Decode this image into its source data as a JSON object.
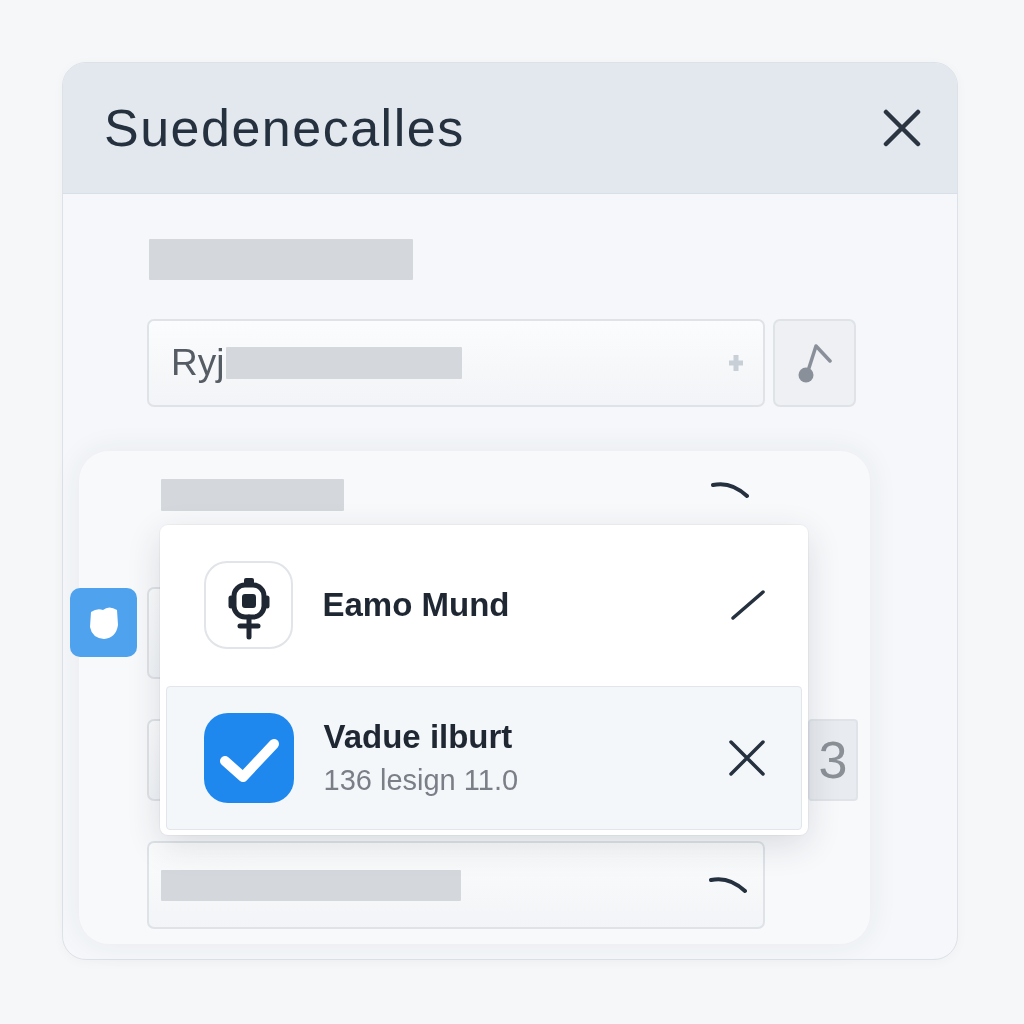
{
  "dialog": {
    "title": "Suedenecalles"
  },
  "name_input": {
    "value": "Ryj"
  },
  "rows": [
    {
      "kind": "badge_field"
    },
    {
      "kind": "count_field",
      "count": "3"
    },
    {
      "kind": "select_field"
    }
  ],
  "dropdown": {
    "expanded": true,
    "options": [
      {
        "title": "Eamo Mund",
        "selected": false
      },
      {
        "title": "Vadue ilburt",
        "subtitle": "136 lesign 11.0",
        "selected": true
      }
    ]
  }
}
